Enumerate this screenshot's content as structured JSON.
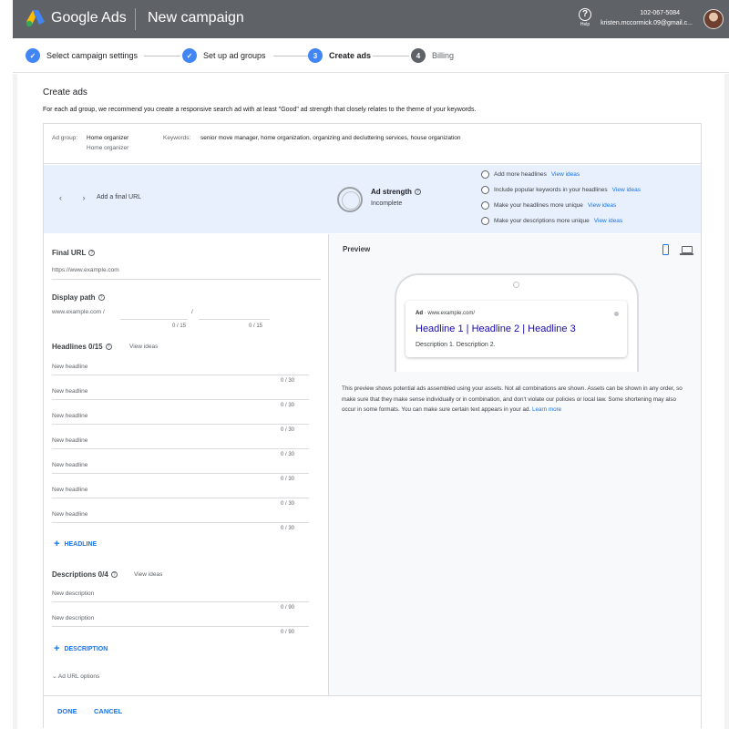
{
  "app": {
    "brand": "Google Ads",
    "page_title": "New campaign",
    "help_label": "Help",
    "account_number": "102-067-5084",
    "account_email": "kristen.mccormick.09@gmail.c...",
    "colors": {
      "topbar": "#5f6368",
      "accent": "#1a73e8",
      "band": "#e8f0fe"
    }
  },
  "stepper": {
    "steps": [
      {
        "label": "Select campaign settings",
        "state": "done",
        "marker": "✓"
      },
      {
        "label": "Set up ad groups",
        "state": "done",
        "marker": "✓"
      },
      {
        "label": "Create ads",
        "state": "current",
        "marker": "3"
      },
      {
        "label": "Billing",
        "state": "todo",
        "marker": "4"
      }
    ]
  },
  "main": {
    "title": "Create ads",
    "intro": "For each ad group, we recommend you create a responsive search ad with at least \"Good\" ad strength that closely relates to the theme of your keywords."
  },
  "ad_group": {
    "label": "Ad group:",
    "value": "Home organizer",
    "value_sub": "Home organizer",
    "keywords_label": "Keywords:",
    "keywords": "senior move manager, home organization, organizing and decluttering services, house organization"
  },
  "strength": {
    "prev_icon": "chevron-left-icon",
    "next_icon": "chevron-right-icon",
    "add_final_url": "Add a final URL",
    "title": "Ad strength",
    "status": "Incomplete",
    "suggestions": [
      {
        "text": "Add more headlines",
        "link": "View ideas"
      },
      {
        "text": "Include popular keywords in your headlines",
        "link": "View ideas"
      },
      {
        "text": "Make your headlines more unique",
        "link": "View ideas"
      },
      {
        "text": "Make your descriptions more unique",
        "link": "View ideas"
      }
    ]
  },
  "form": {
    "final_url": {
      "label": "Final URL",
      "placeholder": "https://www.example.com"
    },
    "display_path": {
      "label": "Display path",
      "prefix": "www.example.com /",
      "separator": "/",
      "path1_count": "0 / 15",
      "path2_count": "0 / 15"
    },
    "headlines": {
      "label": "Headlines 0/15",
      "view_ideas": "View ideas",
      "items": [
        {
          "placeholder": "New headline",
          "count": "0 / 30"
        },
        {
          "placeholder": "New headline",
          "count": "0 / 30"
        },
        {
          "placeholder": "New headline",
          "count": "0 / 30"
        },
        {
          "placeholder": "New headline",
          "count": "0 / 30"
        },
        {
          "placeholder": "New headline",
          "count": "0 / 30"
        },
        {
          "placeholder": "New headline",
          "count": "0 / 30"
        },
        {
          "placeholder": "New headline",
          "count": "0 / 30"
        }
      ],
      "add_label": "HEADLINE"
    },
    "descriptions": {
      "label": "Descriptions 0/4",
      "view_ideas": "View ideas",
      "items": [
        {
          "placeholder": "New description",
          "count": "0 / 90"
        },
        {
          "placeholder": "New description",
          "count": "0 / 90"
        }
      ],
      "add_label": "DESCRIPTION"
    },
    "url_options": "Ad URL options"
  },
  "preview": {
    "title": "Preview",
    "ad_badge": "Ad",
    "ad_url": "· www.example.com/",
    "headline": "Headline 1 | Headline 2 | Headline 3",
    "description": "Description 1. Description 2.",
    "note": "This preview shows potential ads assembled using your assets. Not all combinations are shown. Assets can be shown in any order, so make sure that they make sense individually or in combination, and don't violate our policies or local law. Some shortening may also occur in some formats. You can make sure certain text appears in your ad.",
    "learn_more": "Learn more"
  },
  "footer": {
    "done": "DONE",
    "cancel": "CANCEL"
  }
}
